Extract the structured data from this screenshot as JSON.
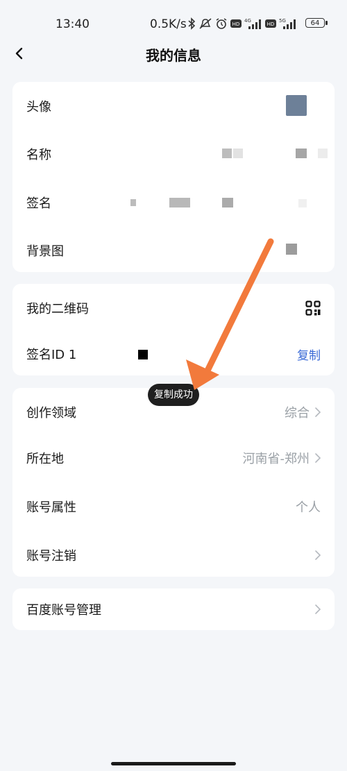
{
  "status_bar": {
    "time": "13:40",
    "net_speed": "0.5K/s",
    "battery": "64",
    "icons": [
      "bluetooth-icon",
      "mute-icon",
      "alarm-icon",
      "hd-icon",
      "4g-signal-icon",
      "hd-icon",
      "5g-signal-icon"
    ]
  },
  "nav": {
    "title": "我的信息",
    "back_icon": "chevron-left-icon"
  },
  "section_profile": {
    "items": [
      {
        "label": "头像"
      },
      {
        "label": "名称"
      },
      {
        "label": "签名"
      },
      {
        "label": "背景图"
      }
    ]
  },
  "section_qr": {
    "qr_label": "我的二维码",
    "qr_icon": "qr-code-icon",
    "id_label": "签名ID 1",
    "copy_label": "复制"
  },
  "toast": "复制成功",
  "section_info": {
    "items": [
      {
        "label": "创作领域",
        "value": "综合"
      },
      {
        "label": "所在地",
        "value": "河南省-郑州"
      },
      {
        "label": "账号属性",
        "value": "个人"
      },
      {
        "label": "账号注销",
        "value": ""
      }
    ]
  },
  "section_baidu": {
    "label": "百度账号管理"
  },
  "colors": {
    "accent": "#3a6ad6",
    "annotation_arrow": "#f27a3c",
    "avatar": "#6d8098"
  }
}
